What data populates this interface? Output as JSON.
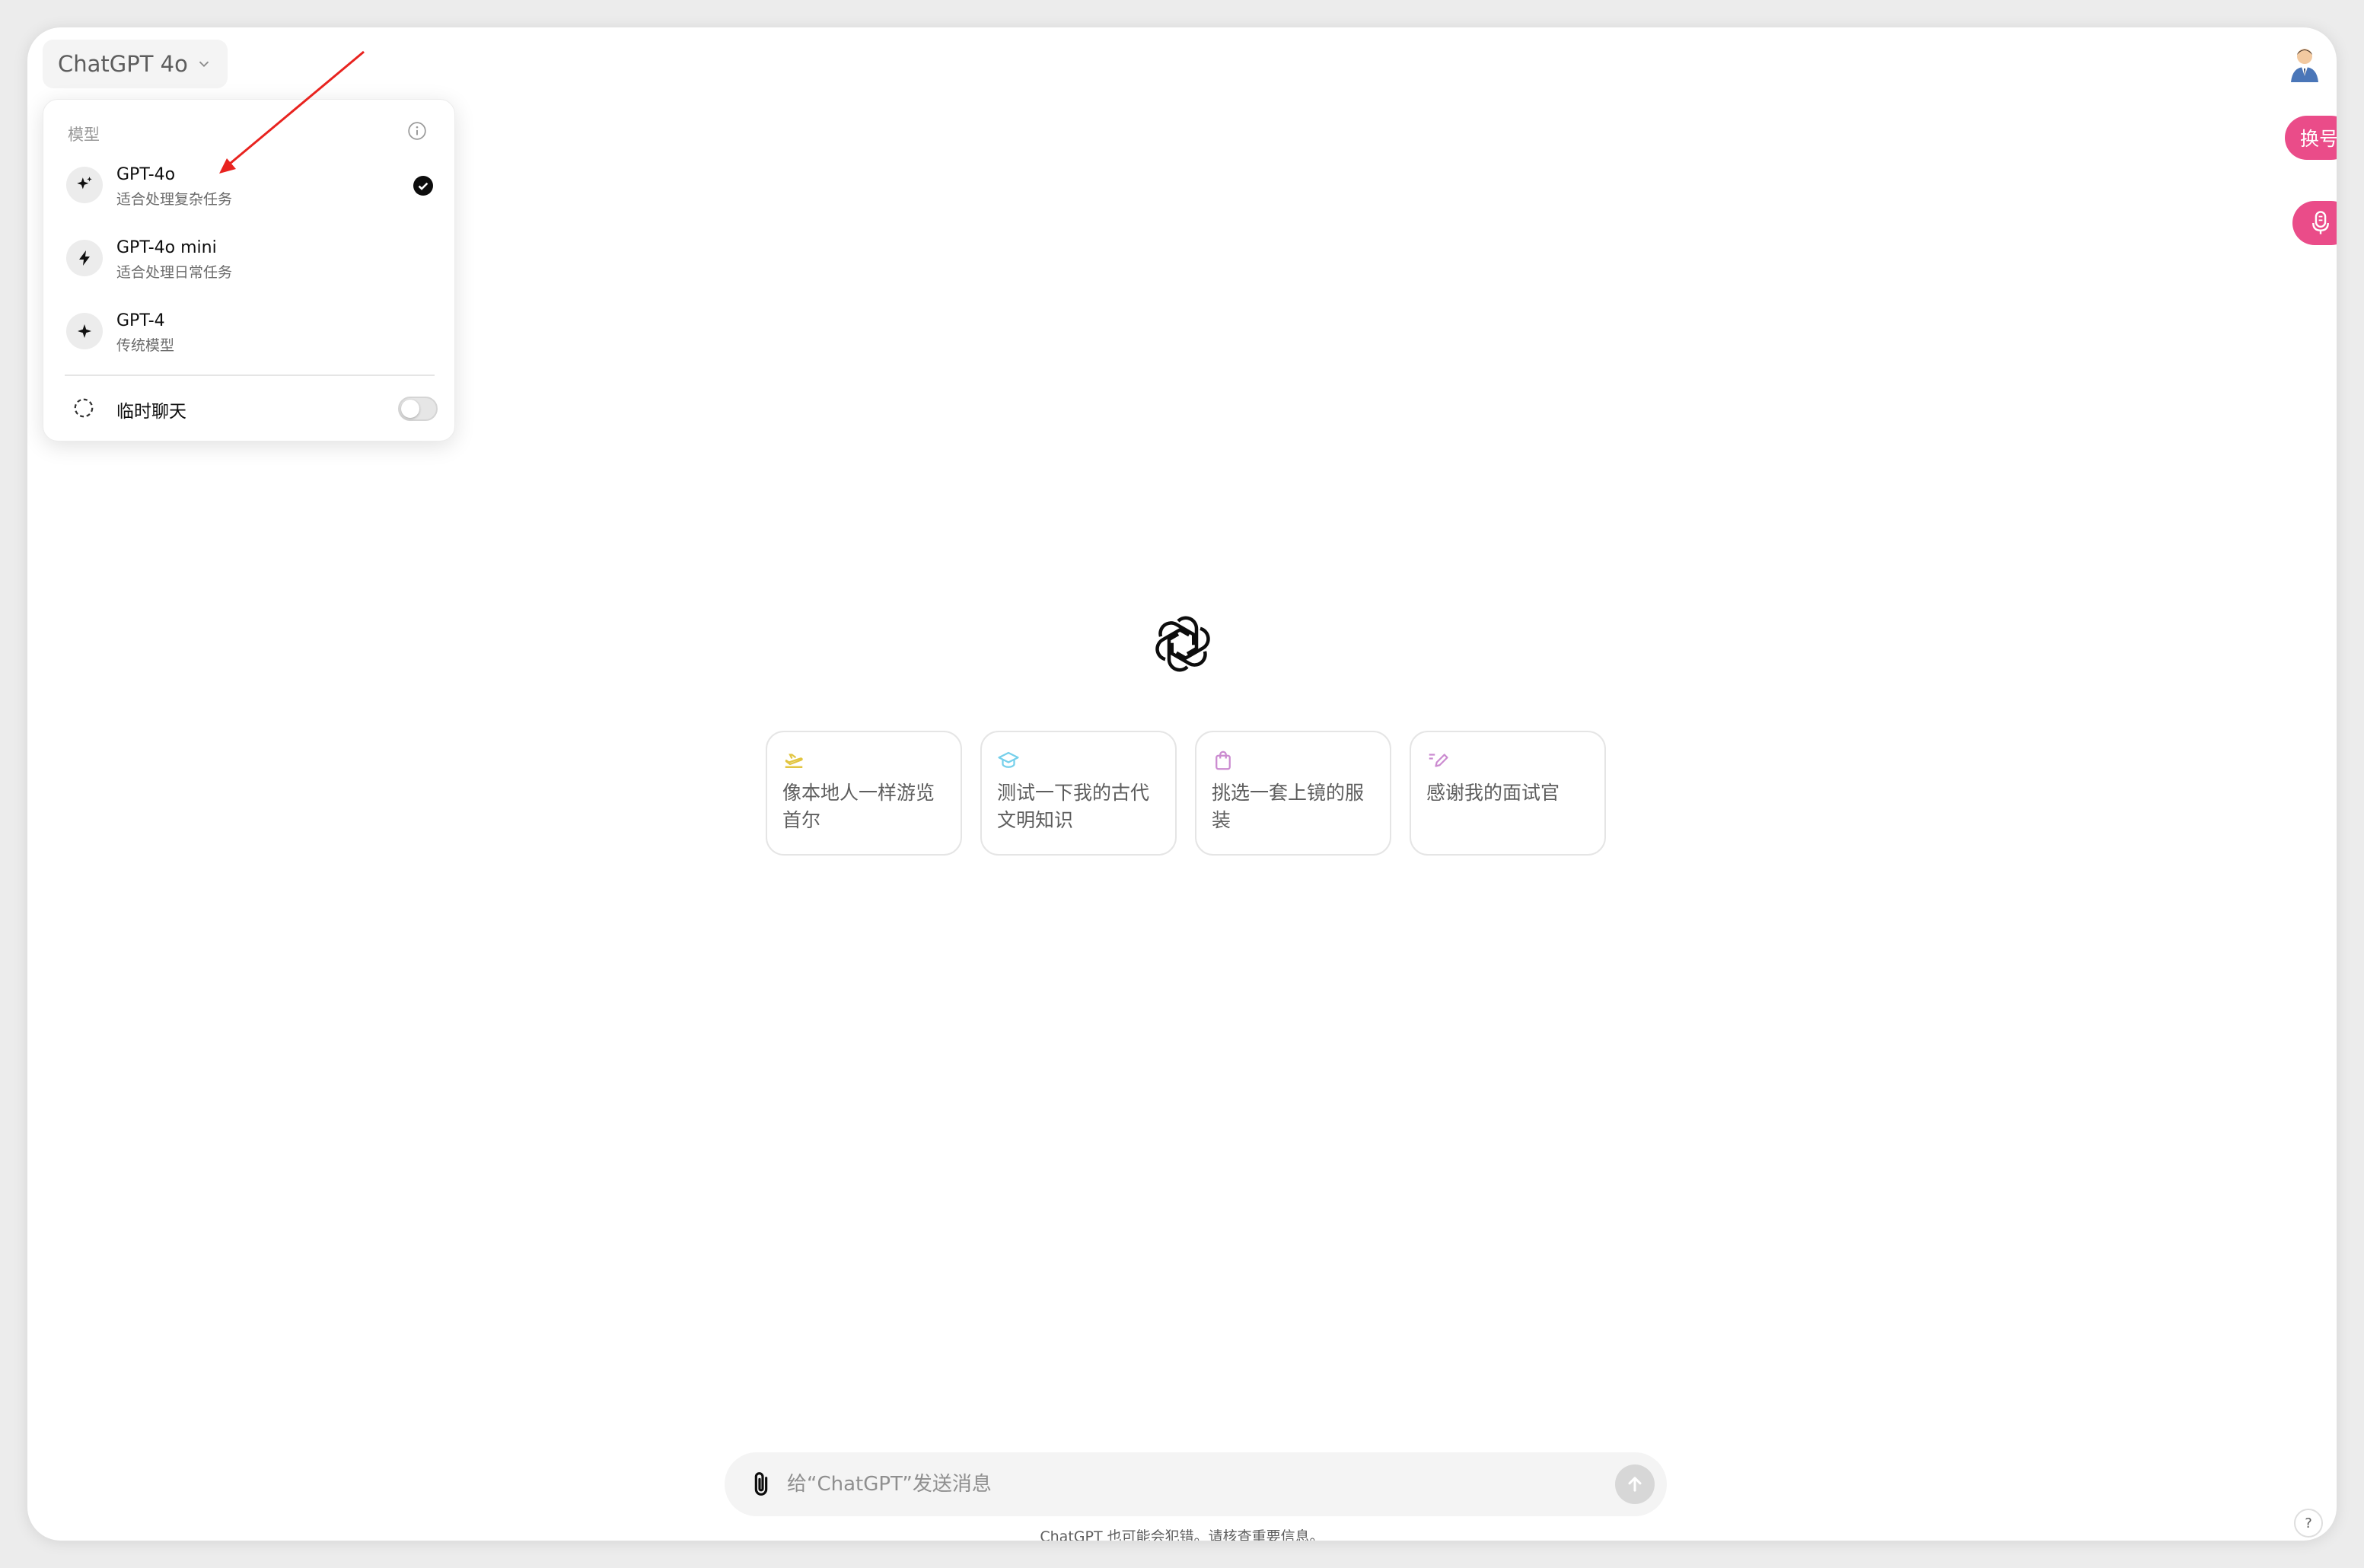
{
  "header": {
    "model_label": "ChatGPT 4o"
  },
  "dropdown": {
    "section_label": "模型",
    "models": [
      {
        "name": "GPT-4o",
        "desc": "适合处理复杂任务",
        "selected": true,
        "icon": "sparkles-icon"
      },
      {
        "name": "GPT-4o mini",
        "desc": "适合处理日常任务",
        "selected": false,
        "icon": "lightning-icon"
      },
      {
        "name": "GPT-4",
        "desc": "传统模型",
        "selected": false,
        "icon": "sparkle-icon"
      }
    ],
    "temporary_chat": {
      "label": "临时聊天",
      "enabled": false
    }
  },
  "side_buttons": {
    "switch_account": "换号"
  },
  "cards": [
    {
      "text": "像本地人一样游览首尔",
      "icon": "airplane-icon",
      "color": "#e2c541"
    },
    {
      "text": "测试一下我的古代文明知识",
      "icon": "graduation-cap-icon",
      "color": "#76d0eb"
    },
    {
      "text": "挑选一套上镜的服装",
      "icon": "shopping-bag-icon",
      "color": "#cb8bd0"
    },
    {
      "text": "感谢我的面试官",
      "icon": "pen-icon",
      "color": "#cb8bd0"
    }
  ],
  "composer": {
    "placeholder": "给“ChatGPT”发送消息"
  },
  "footer": {
    "disclaimer": "ChatGPT 也可能会犯错。请核查重要信息。",
    "help": "?"
  },
  "colors": {
    "accent_pink": "#ea4c89",
    "annotation_arrow": "#e8231f"
  }
}
